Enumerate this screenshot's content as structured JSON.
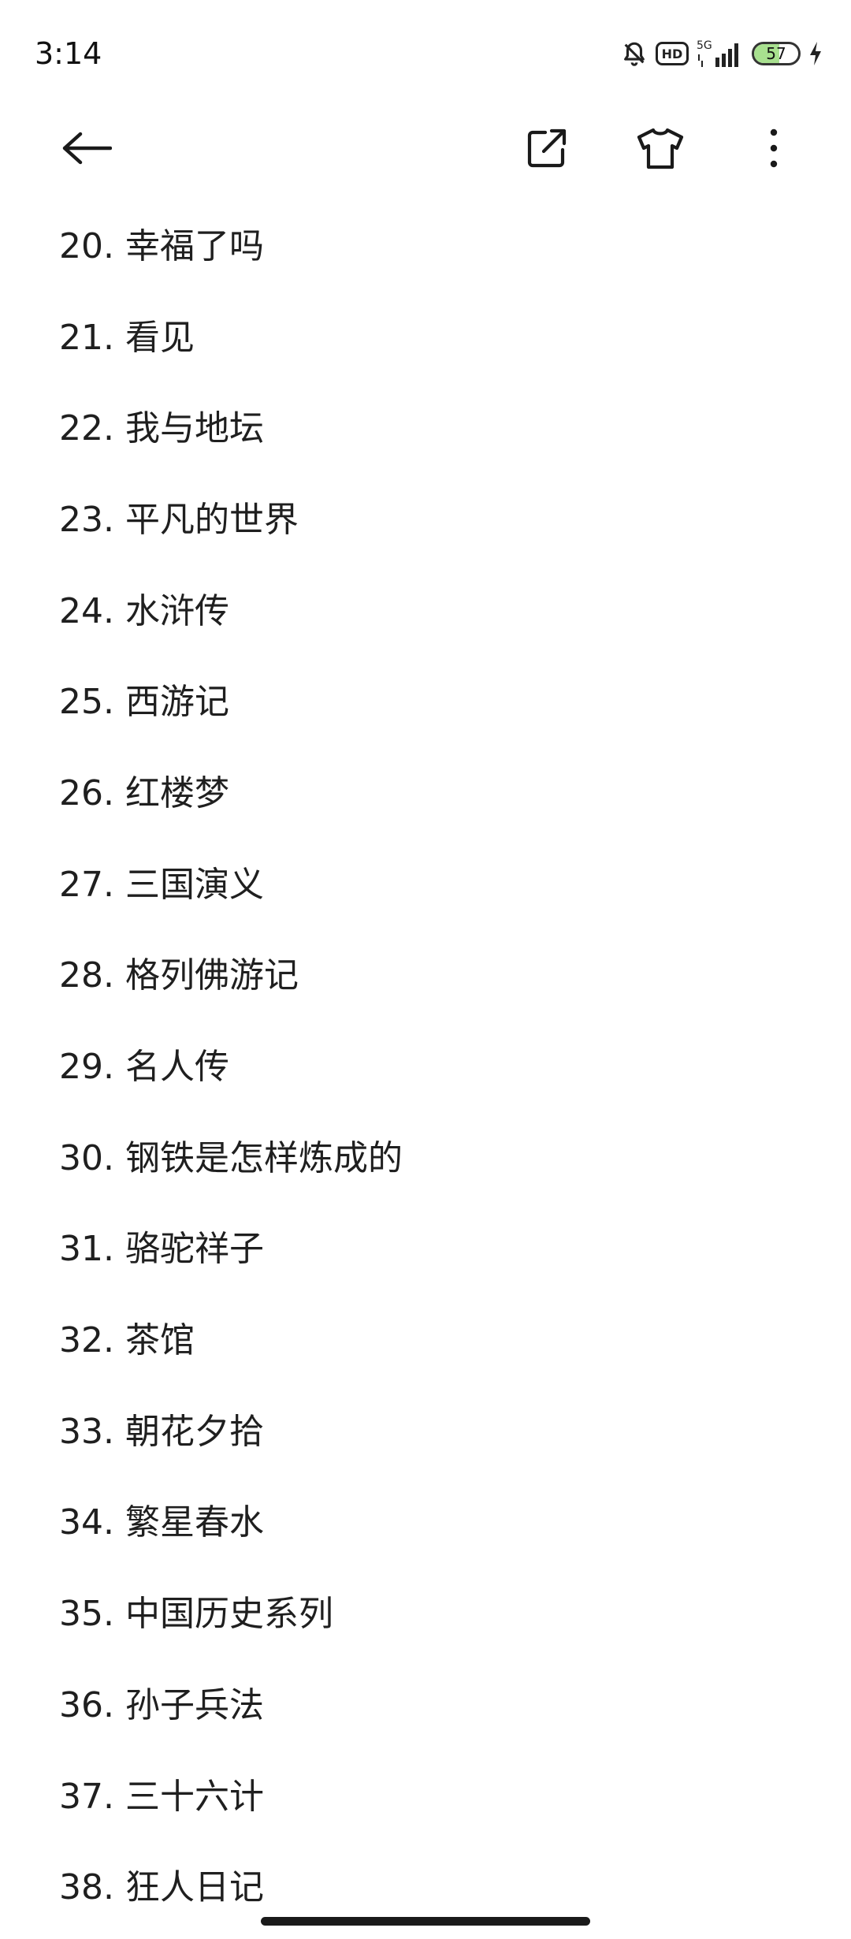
{
  "status_bar": {
    "time": "3:14",
    "network": "5G",
    "battery_level": "57",
    "battery_fraction": 0.57,
    "hd_label": "HD",
    "icons": [
      "alarm-icon",
      "hd-icon",
      "signal-icon",
      "battery-icon",
      "charging-icon"
    ]
  },
  "toolbar": {
    "icons": [
      "back-arrow-icon",
      "share-icon",
      "tshirt-icon",
      "more-vertical-icon"
    ]
  },
  "list": {
    "items": [
      "20. 幸福了吗",
      "21. 看见",
      "22. 我与地坛",
      "23. 平凡的世界",
      "24. 水浒传",
      "25. 西游记",
      "26. 红楼梦",
      "27. 三国演义",
      "28. 格列佛游记",
      "29. 名人传",
      "30. 钢铁是怎样炼成的",
      "31. 骆驼祥子",
      "32. 茶馆",
      "33. 朝花夕拾",
      "34. 繁星春水",
      "35. 中国历史系列",
      "36. 孙子兵法",
      "37. 三十六计",
      "38. 狂人日记"
    ]
  }
}
